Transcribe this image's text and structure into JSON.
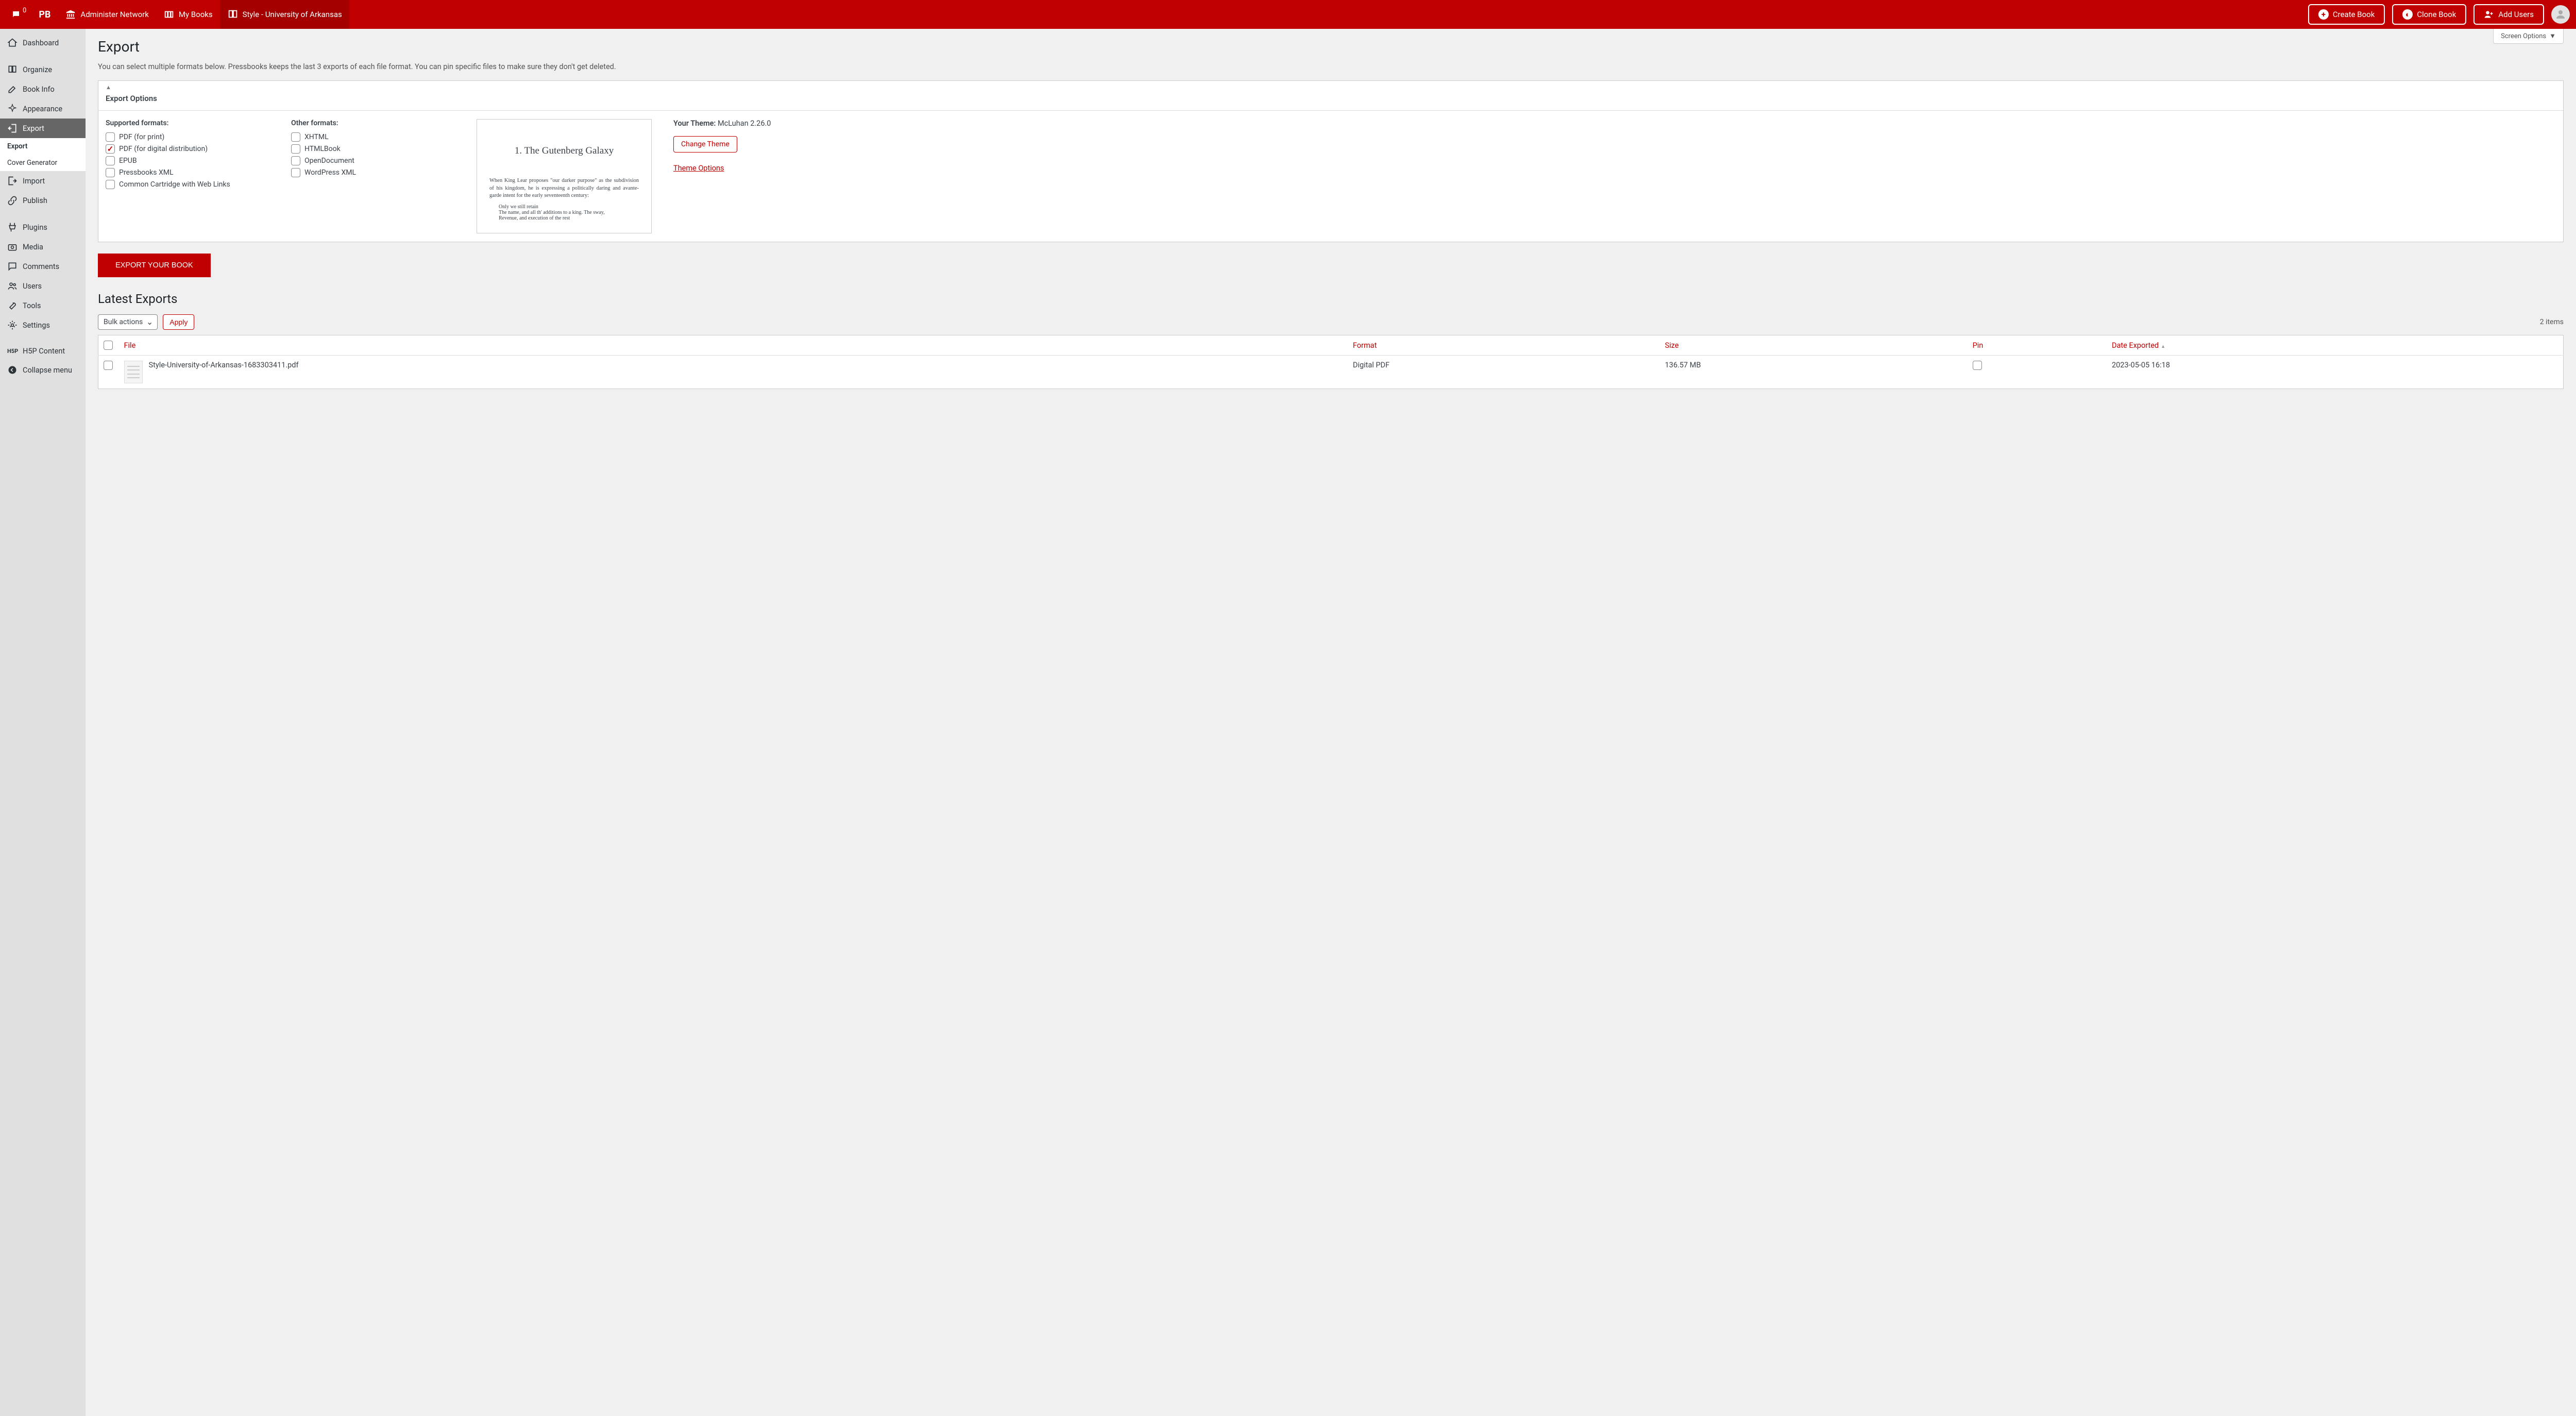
{
  "topbar": {
    "notif_count": "0",
    "pb_label": "PB",
    "administer": "Administer Network",
    "my_books": "My Books",
    "book_title": "Style - University of Arkansas",
    "create_book": "Create Book",
    "clone_book": "Clone Book",
    "add_users": "Add Users"
  },
  "sidebar": {
    "dashboard": "Dashboard",
    "organize": "Organize",
    "book_info": "Book Info",
    "appearance": "Appearance",
    "export": "Export",
    "export_sub": "Export",
    "cover_gen": "Cover Generator",
    "import": "Import",
    "publish": "Publish",
    "plugins": "Plugins",
    "media": "Media",
    "comments": "Comments",
    "users": "Users",
    "tools": "Tools",
    "settings": "Settings",
    "h5p": "H5P Content",
    "collapse": "Collapse menu"
  },
  "screen_options": "Screen Options",
  "page_title": "Export",
  "subtitle": "You can select multiple formats below. Pressbooks keeps the last 3 exports of each file format. You can pin specific files to make sure they don't get deleted.",
  "export_options_title": "Export Options",
  "supported_heading": "Supported formats:",
  "other_heading": "Other formats:",
  "supported_formats": [
    {
      "label": "PDF (for print)",
      "checked": false
    },
    {
      "label": "PDF (for digital distribution)",
      "checked": true
    },
    {
      "label": "EPUB",
      "checked": false
    },
    {
      "label": "Pressbooks XML",
      "checked": false
    },
    {
      "label": "Common Cartridge with Web Links",
      "checked": false
    }
  ],
  "other_formats": [
    {
      "label": "XHTML",
      "checked": false
    },
    {
      "label": "HTMLBook",
      "checked": false
    },
    {
      "label": "OpenDocument",
      "checked": false
    },
    {
      "label": "WordPress XML",
      "checked": false
    }
  ],
  "preview": {
    "title": "1. The Gutenberg Galaxy",
    "body": "When King Lear proposes \"our darker purpose\" as the subdivision of his kingdom, he is expressing a politically daring and avante-garde intent for the early seventeenth century:",
    "indent1": "Only we still retain",
    "indent2": "The name, and all th' additions to a king. The sway,",
    "indent3": "Revenue, and execution of the rest"
  },
  "theme": {
    "label": "Your Theme:",
    "value": "McLuhan 2.26.0",
    "change_btn": "Change Theme",
    "options_link": "Theme Options"
  },
  "export_button": "EXPORT YOUR BOOK",
  "latest_heading": "Latest Exports",
  "bulk_select": "Bulk actions",
  "apply": "Apply",
  "items_count": "2 items",
  "columns": {
    "file": "File",
    "format": "Format",
    "size": "Size",
    "pin": "Pin",
    "date": "Date Exported"
  },
  "rows": [
    {
      "file": "Style-University-of-Arkansas-1683303411.pdf",
      "format": "Digital PDF",
      "size": "136.57 MB",
      "pinned": false,
      "date": "2023-05-05 16:18"
    }
  ]
}
